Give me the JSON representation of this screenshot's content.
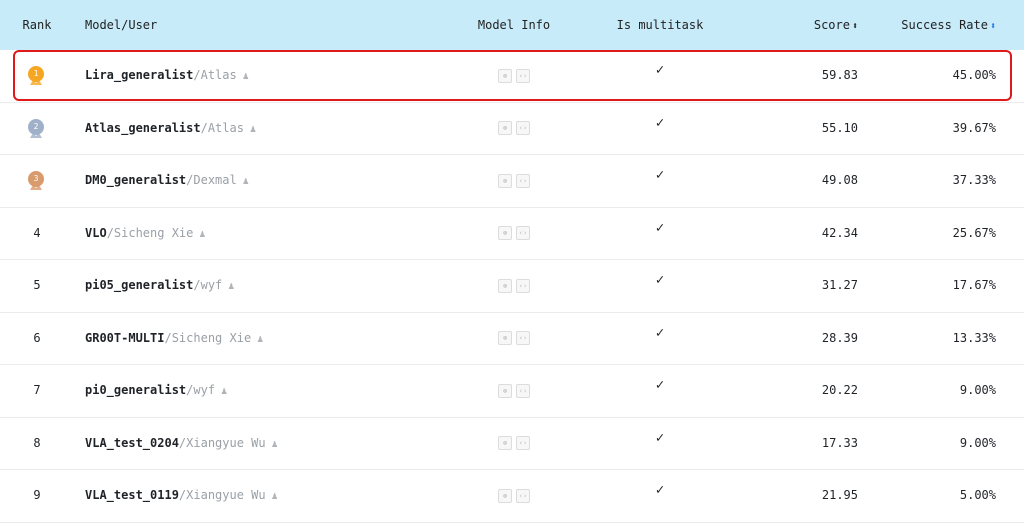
{
  "table": {
    "headers": {
      "rank": "Rank",
      "model": "Model/User",
      "info": "Model Info",
      "multitask": "Is multitask",
      "score": "Score",
      "rate": "Success Rate"
    },
    "sort_glyph": "⬍",
    "info_glyphs": [
      "⊛",
      "‹›"
    ],
    "user_glyph": "♟",
    "medal_colors": [
      "#f5a623",
      "#9fb0c8",
      "#d99a6c"
    ],
    "rows": [
      {
        "rank": "1",
        "name": "Lira_generalist",
        "user": "/Atlas",
        "multitask": "✓",
        "score": "59.83",
        "rate": "45.00%"
      },
      {
        "rank": "2",
        "name": "Atlas_generalist",
        "user": "/Atlas",
        "multitask": "✓",
        "score": "55.10",
        "rate": "39.67%"
      },
      {
        "rank": "3",
        "name": "DM0_generalist",
        "user": "/Dexmal",
        "multitask": "✓",
        "score": "49.08",
        "rate": "37.33%"
      },
      {
        "rank": "4",
        "name": "VLO",
        "user": "/Sicheng Xie",
        "multitask": "✓",
        "score": "42.34",
        "rate": "25.67%"
      },
      {
        "rank": "5",
        "name": "pi05_generalist",
        "user": "/wyf",
        "multitask": "✓",
        "score": "31.27",
        "rate": "17.67%"
      },
      {
        "rank": "6",
        "name": "GR00T-MULTI",
        "user": "/Sicheng Xie",
        "multitask": "✓",
        "score": "28.39",
        "rate": "13.33%"
      },
      {
        "rank": "7",
        "name": "pi0_generalist",
        "user": "/wyf",
        "multitask": "✓",
        "score": "20.22",
        "rate": "9.00%"
      },
      {
        "rank": "8",
        "name": "VLA_test_0204",
        "user": "/Xiangyue Wu",
        "multitask": "✓",
        "score": "17.33",
        "rate": "9.00%"
      },
      {
        "rank": "9",
        "name": "VLA_test_0119",
        "user": "/Xiangyue Wu",
        "multitask": "✓",
        "score": "21.95",
        "rate": "5.00%"
      }
    ]
  }
}
